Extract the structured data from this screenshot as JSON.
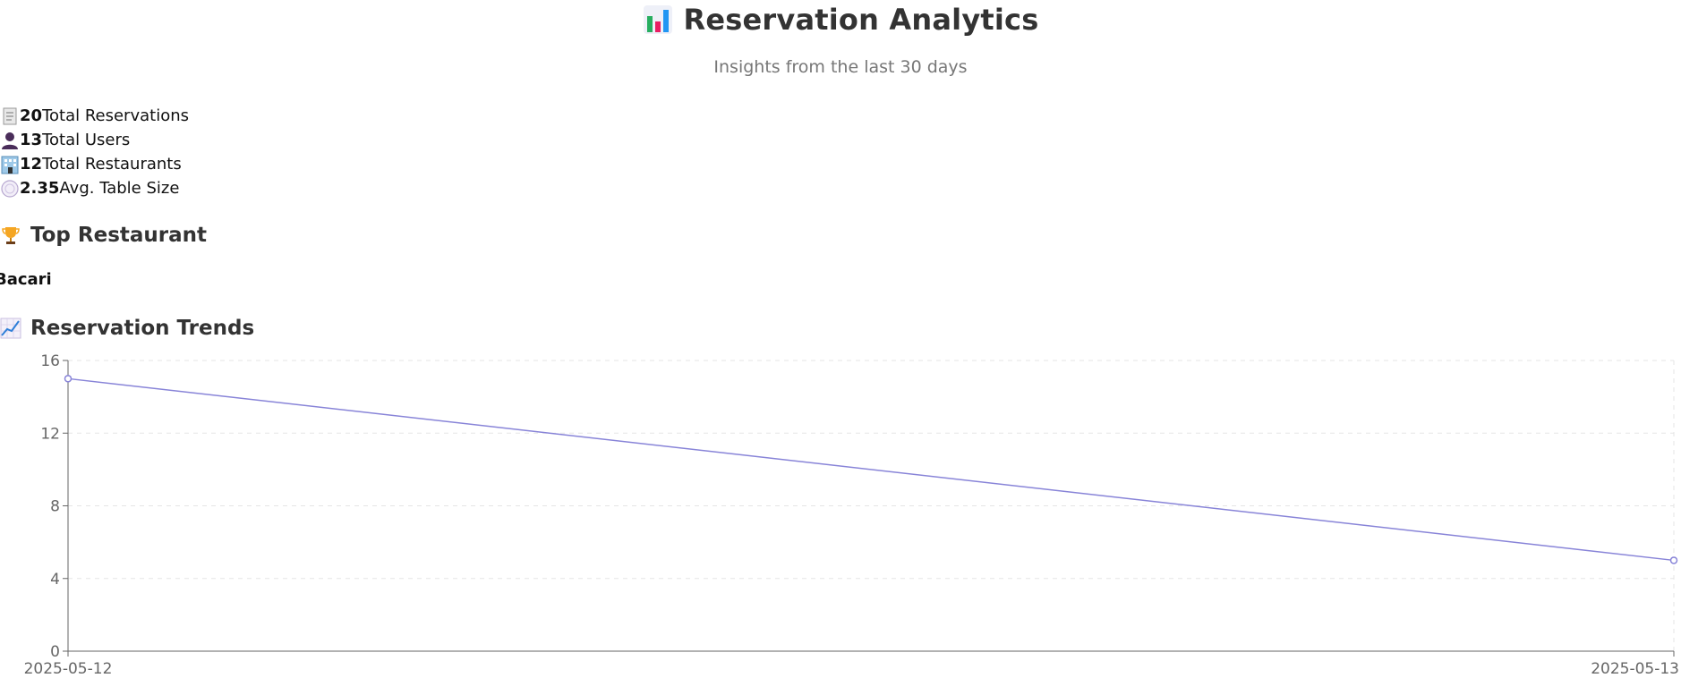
{
  "header": {
    "title": "Reservation Analytics",
    "subtitle": "Insights from the last 30 days",
    "title_icon": "bar-chart-icon"
  },
  "stats": [
    {
      "icon": "receipt-icon",
      "value": "20",
      "label": "Total Reservations"
    },
    {
      "icon": "user-icon",
      "value": "13",
      "label": "Total Users"
    },
    {
      "icon": "building-icon",
      "value": "12",
      "label": "Total Restaurants"
    },
    {
      "icon": "plate-icon",
      "value": "2.35",
      "label": "Avg. Table Size"
    }
  ],
  "top_restaurant": {
    "heading": "Top Restaurant",
    "icon": "trophy-icon",
    "name": "Bacari"
  },
  "trends": {
    "heading": "Reservation Trends",
    "icon": "line-chart-icon"
  },
  "colors": {
    "line": "#8884d8",
    "axis": "#666666",
    "grid": "#e5e5e5"
  },
  "chart_data": {
    "type": "line",
    "x": [
      "2025-05-12",
      "2025-05-13"
    ],
    "series": [
      {
        "values": [
          15,
          5
        ]
      }
    ],
    "ylim": [
      0,
      16
    ],
    "yticks": [
      0,
      4,
      8,
      12,
      16
    ],
    "grid": true,
    "xlabel": "",
    "ylabel": ""
  }
}
